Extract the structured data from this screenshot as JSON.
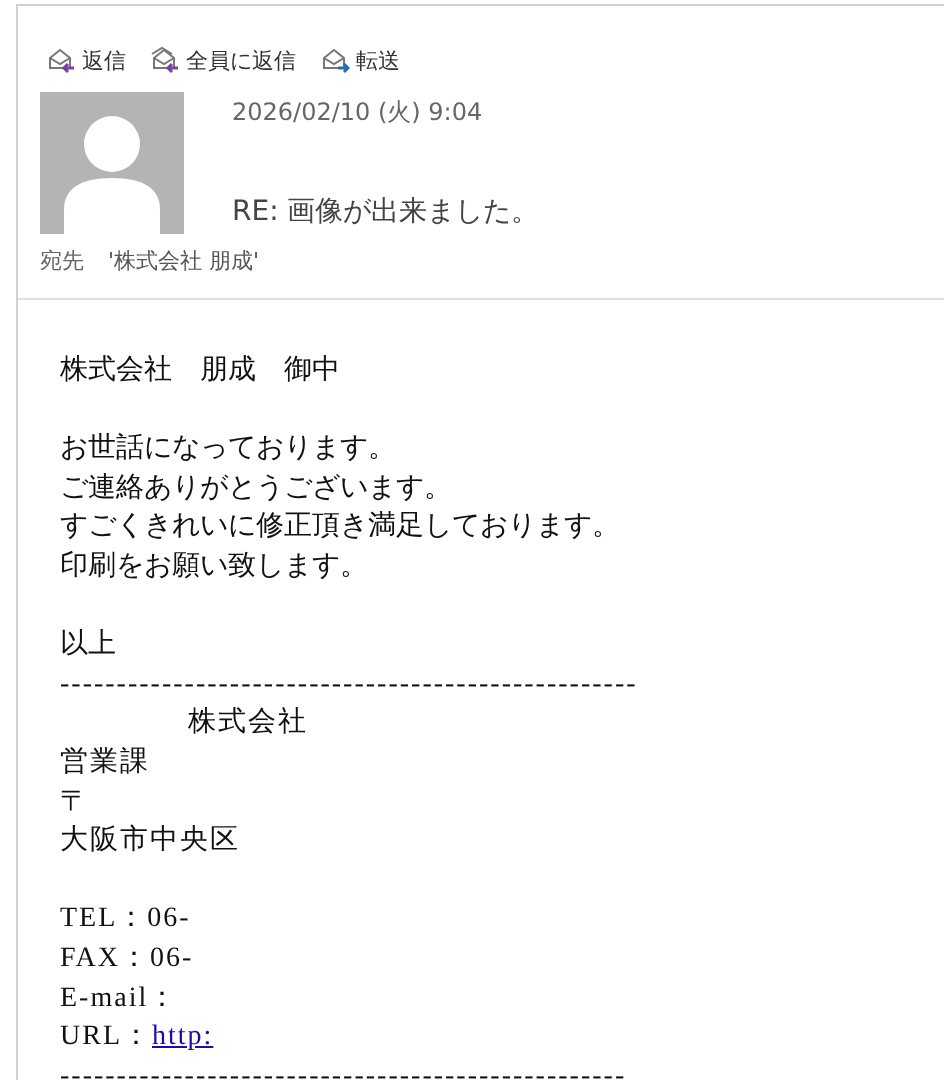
{
  "toolbar": [
    {
      "label": "返信",
      "kind": "reply"
    },
    {
      "label": "全員に返信",
      "kind": "reply-all"
    },
    {
      "label": "転送",
      "kind": "forward"
    }
  ],
  "header": {
    "date": "2026/02/10 (火) 9:04",
    "subject": "RE: 画像が出来ました。",
    "to_label": "宛先",
    "to": "'株式会社 朋成'"
  },
  "body": [
    {
      "kind": "text",
      "text": "株式会社　朋成　御中"
    },
    {
      "kind": "blank"
    },
    {
      "kind": "text",
      "text": "お世話になっております。"
    },
    {
      "kind": "text",
      "text": "ご連絡ありがとうございます。"
    },
    {
      "kind": "text",
      "text": "すごくきれいに修正頂き満足しております。"
    },
    {
      "kind": "text",
      "text": "印刷をお願い致します。"
    },
    {
      "kind": "blank"
    },
    {
      "kind": "text",
      "text": "以上"
    },
    {
      "kind": "sig",
      "text": "---------------------------------------------------"
    },
    {
      "kind": "sig-indent",
      "text": "株式会社"
    },
    {
      "kind": "sig",
      "text": "営業課"
    },
    {
      "kind": "sig",
      "text": "〒"
    },
    {
      "kind": "sig",
      "text": "大阪市中央区"
    },
    {
      "kind": "blank"
    },
    {
      "kind": "sig",
      "text": "TEL：06-"
    },
    {
      "kind": "sig",
      "text": "FAX：06-"
    },
    {
      "kind": "sig",
      "text": "E-mail："
    },
    {
      "kind": "link",
      "text": "URL：",
      "link": "http:"
    },
    {
      "kind": "sig",
      "text": "--------------------------------------------------"
    }
  ]
}
